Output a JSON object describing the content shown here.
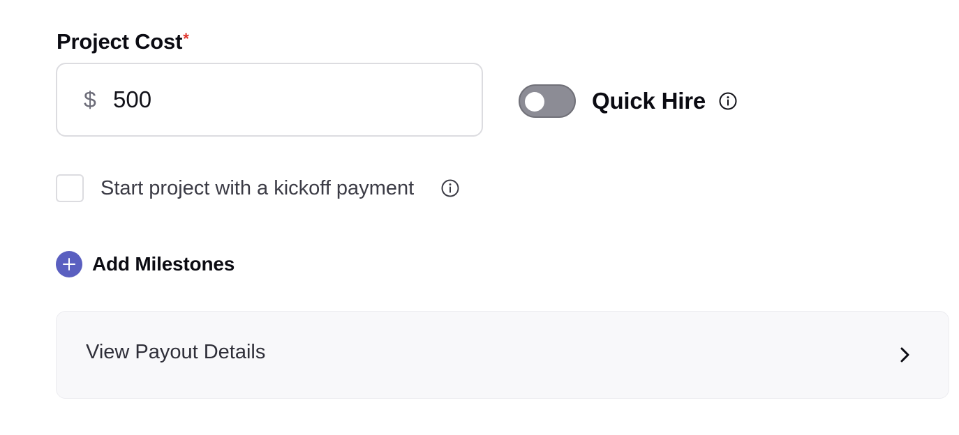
{
  "project_cost": {
    "label": "Project Cost",
    "required_marker": "*",
    "currency_symbol": "$",
    "value": "500"
  },
  "quick_hire": {
    "label": "Quick Hire",
    "enabled": false,
    "info_icon": "info-circle-icon"
  },
  "kickoff_payment": {
    "label": "Start project with a kickoff payment",
    "checked": false,
    "info_icon": "info-circle-icon"
  },
  "milestones": {
    "add_label": "Add Milestones",
    "icon": "plus-circle-icon"
  },
  "payout": {
    "label": "View Payout Details",
    "icon": "chevron-right-icon"
  },
  "colors": {
    "accent": "#5a5fc0",
    "required": "#e0342b",
    "toggle_off": "#8c8c95",
    "card_bg": "#f8f8fa"
  }
}
